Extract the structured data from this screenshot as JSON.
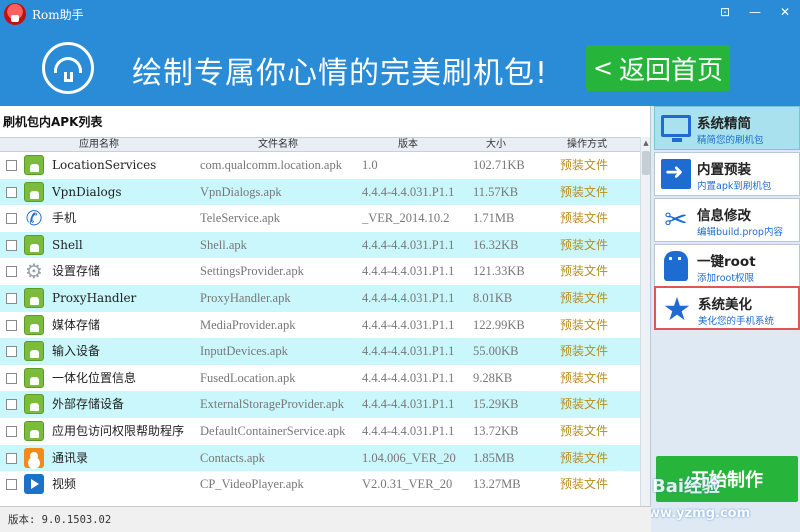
{
  "window": {
    "title": "Rom助手",
    "controls": [
      "⊡",
      "—",
      "✕"
    ]
  },
  "banner": {
    "slogan": "绘制专属你心情的完美刷机包!",
    "home_chevron": "<",
    "home_label": "返回首页"
  },
  "list": {
    "title": "刷机包内APK列表",
    "columns": [
      "应用名称",
      "文件名称",
      "版本",
      "大小",
      "操作方式"
    ],
    "rows": [
      {
        "icon": "android-icon",
        "name": "LocationServices",
        "file": "com.qualcomm.location.apk",
        "version": "1.0",
        "size": "102.71KB",
        "action": "预装文件"
      },
      {
        "icon": "android-icon",
        "name": "VpnDialogs",
        "file": "VpnDialogs.apk",
        "version": "4.4.4-4.4.031.P1.1",
        "size": "11.57KB",
        "action": "预装文件"
      },
      {
        "icon": "phone-icon",
        "name": "手机",
        "file": "TeleService.apk",
        "version": "_VER_2014.10.2",
        "size": "1.71MB",
        "action": "预装文件"
      },
      {
        "icon": "android-icon",
        "name": "Shell",
        "file": "Shell.apk",
        "version": "4.4.4-4.4.031.P1.1",
        "size": "16.32KB",
        "action": "预装文件"
      },
      {
        "icon": "gear-icon",
        "name": "设置存储",
        "file": "SettingsProvider.apk",
        "version": "4.4.4-4.4.031.P1.1",
        "size": "121.33KB",
        "action": "预装文件"
      },
      {
        "icon": "android-icon",
        "name": "ProxyHandler",
        "file": "ProxyHandler.apk",
        "version": "4.4.4-4.4.031.P1.1",
        "size": "8.01KB",
        "action": "预装文件"
      },
      {
        "icon": "android-icon",
        "name": "媒体存储",
        "file": "MediaProvider.apk",
        "version": "4.4.4-4.4.031.P1.1",
        "size": "122.99KB",
        "action": "预装文件"
      },
      {
        "icon": "android-icon",
        "name": "输入设备",
        "file": "InputDevices.apk",
        "version": "4.4.4-4.4.031.P1.1",
        "size": "55.00KB",
        "action": "预装文件"
      },
      {
        "icon": "android-icon",
        "name": "一体化位置信息",
        "file": "FusedLocation.apk",
        "version": "4.4.4-4.4.031.P1.1",
        "size": "9.28KB",
        "action": "预装文件"
      },
      {
        "icon": "android-icon",
        "name": "外部存储设备",
        "file": "ExternalStorageProvider.apk",
        "version": "4.4.4-4.4.031.P1.1",
        "size": "15.29KB",
        "action": "预装文件"
      },
      {
        "icon": "android-icon",
        "name": "应用包访问权限帮助程序",
        "file": "DefaultContainerService.apk",
        "version": "4.4.4-4.4.031.P1.1",
        "size": "13.72KB",
        "action": "预装文件"
      },
      {
        "icon": "contacts-icon",
        "name": "通讯录",
        "file": "Contacts.apk",
        "version": "1.04.006_VER_20",
        "size": "1.85MB",
        "action": "预装文件"
      },
      {
        "icon": "video-icon",
        "name": "视频",
        "file": "CP_VideoPlayer.apk",
        "version": "V2.0.31_VER_20",
        "size": "13.27MB",
        "action": "预装文件"
      }
    ]
  },
  "sidebar": {
    "items": [
      {
        "title": "系统精简",
        "subtitle": "精简您的刷机包",
        "icon": "monitor-icon"
      },
      {
        "title": "内置预装",
        "subtitle": "内置apk到刷机包",
        "icon": "install-icon"
      },
      {
        "title": "信息修改",
        "subtitle": "编辑build.prop内容",
        "icon": "tools-icon"
      },
      {
        "title": "一键root",
        "subtitle": "添加root权限",
        "icon": "android-robot-icon"
      },
      {
        "title": "系统美化",
        "subtitle": "美化您的手机系统",
        "icon": "star-icon"
      }
    ],
    "start_label": "开始制作"
  },
  "status": {
    "version_label": "版本: 9.0.1503.02"
  },
  "watermark": {
    "text": "Bai经验",
    "domain": "www.yzmg.com"
  },
  "colors": {
    "header_blue": "#2a8bd6",
    "accent_green": "#27b43a",
    "row_alt": "#c9f7fb",
    "action_gold": "#b88e1c",
    "sidebar_blue": "#1e6bd1"
  }
}
